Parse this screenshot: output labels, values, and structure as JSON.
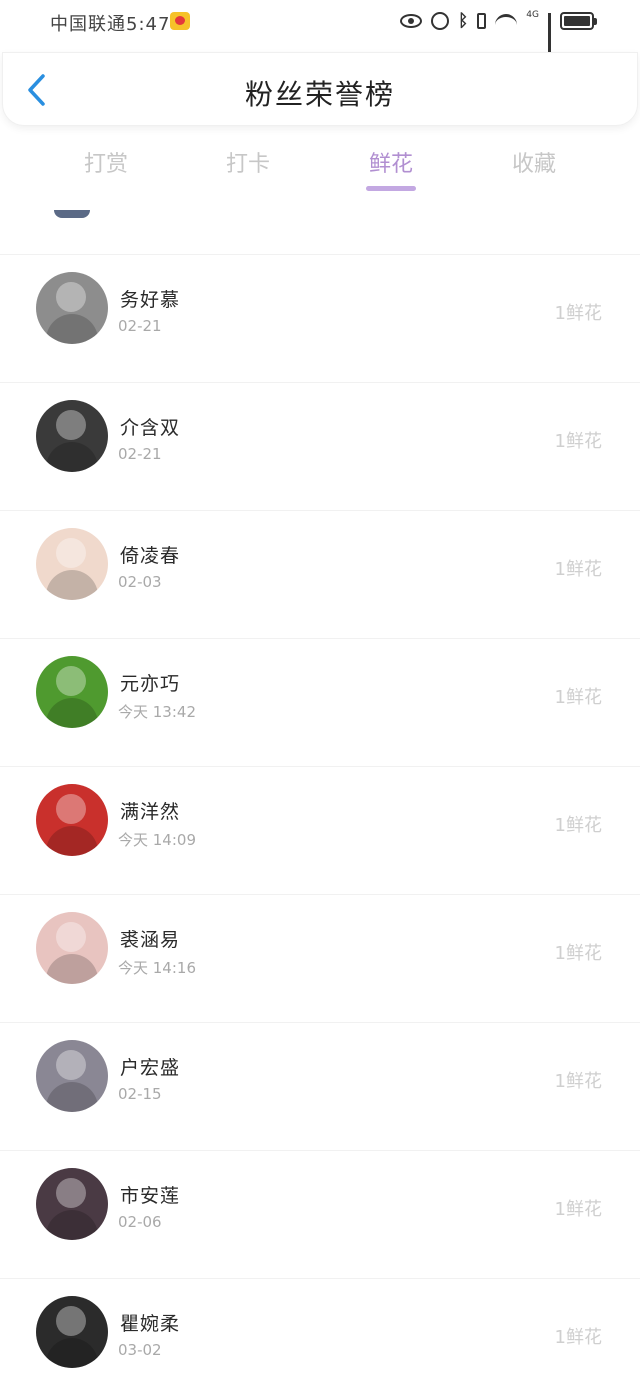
{
  "status_bar": {
    "carrier_time": "中国联通5:47",
    "network": "4G"
  },
  "header": {
    "title": "粉丝荣誉榜"
  },
  "tabs": [
    {
      "label": "打赏"
    },
    {
      "label": "打卡"
    },
    {
      "label": "鲜花"
    },
    {
      "label": "收藏"
    }
  ],
  "active_tab": "鲜花",
  "colors": {
    "accent": "#b18fd1",
    "indicator": "#c3a8e2",
    "back_arrow": "#2a8fe0"
  },
  "fans": [
    {
      "name": "务好慕",
      "date": "02-21",
      "count": "1鲜花",
      "avatar_color": "#8d8d8d"
    },
    {
      "name": "介含双",
      "date": "02-21",
      "count": "1鲜花",
      "avatar_color": "#3a3a3a"
    },
    {
      "name": "倚凌春",
      "date": "02-03",
      "count": "1鲜花",
      "avatar_color": "#f0d9cc"
    },
    {
      "name": "元亦巧",
      "date": "今天 13:42",
      "count": "1鲜花",
      "avatar_color": "#4f9a2f"
    },
    {
      "name": "满洋然",
      "date": "今天 14:09",
      "count": "1鲜花",
      "avatar_color": "#c9302c"
    },
    {
      "name": "裘涵易",
      "date": "今天 14:16",
      "count": "1鲜花",
      "avatar_color": "#e8c4c0"
    },
    {
      "name": "户宏盛",
      "date": "02-15",
      "count": "1鲜花",
      "avatar_color": "#8a8794"
    },
    {
      "name": "市安莲",
      "date": "02-06",
      "count": "1鲜花",
      "avatar_color": "#4a3a44"
    },
    {
      "name": "瞿婉柔",
      "date": "03-02",
      "count": "1鲜花",
      "avatar_color": "#2b2b2b"
    }
  ]
}
